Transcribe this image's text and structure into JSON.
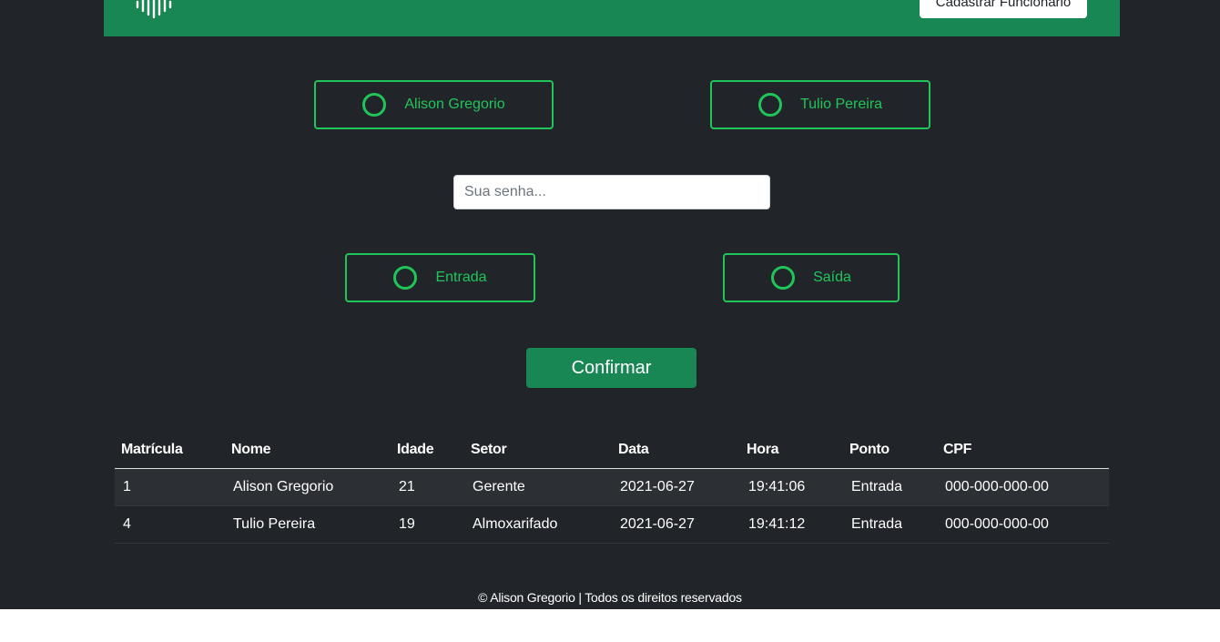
{
  "navbar": {
    "logo_icon": "fingerprint-icon",
    "register_button": "Cadastrar Funcionário"
  },
  "employees": [
    {
      "label": "Alison Gregorio"
    },
    {
      "label": "Tulio Pereira"
    }
  ],
  "password": {
    "placeholder": "Sua senha...",
    "value": ""
  },
  "punch_types": [
    {
      "label": "Entrada"
    },
    {
      "label": "Saída"
    }
  ],
  "confirm_label": "Confirmar",
  "table": {
    "headers": [
      "Matrícula",
      "Nome",
      "Idade",
      "Setor",
      "Data",
      "Hora",
      "Ponto",
      "CPF"
    ],
    "rows": [
      [
        "1",
        "Alison Gregorio",
        "21",
        "Gerente",
        "2021-06-27",
        "19:41:06",
        "Entrada",
        "000-000-000-00"
      ],
      [
        "4",
        "Tulio Pereira",
        "19",
        "Almoxarifado",
        "2021-06-27",
        "19:41:12",
        "Entrada",
        "000-000-000-00"
      ]
    ]
  },
  "footer": "© Alison Gregorio | Todos os direitos reservados",
  "colors": {
    "brand_green": "#198754",
    "accent_green": "#20c55a",
    "background": "#212529"
  }
}
